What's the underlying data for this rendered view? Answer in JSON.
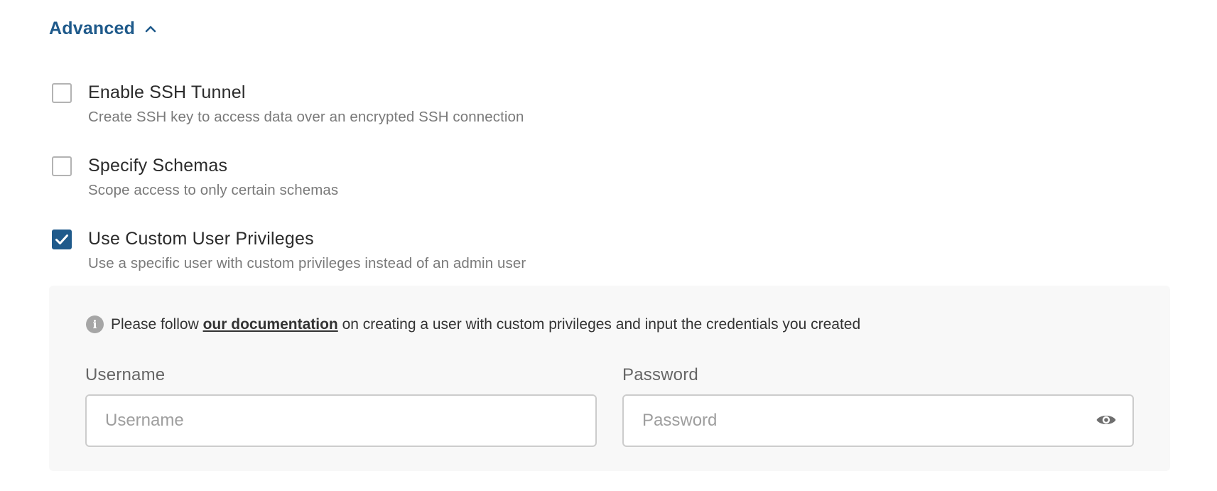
{
  "advanced": {
    "label": "Advanced",
    "expanded": true,
    "icon": "chevron-up-icon",
    "color": "#1f5a8b"
  },
  "options": [
    {
      "title": "Enable SSH Tunnel",
      "description": "Create SSH key to access data over an encrypted SSH connection",
      "checked": false
    },
    {
      "title": "Specify Schemas",
      "description": "Scope access to only certain schemas",
      "checked": false
    },
    {
      "title": "Use Custom User Privileges",
      "description": "Use a specific user with custom privileges instead of an admin user",
      "checked": true
    }
  ],
  "panel": {
    "info_prefix": "Please follow",
    "info_link": "our documentation",
    "info_suffix": "on creating a user with custom privileges and input the credentials you created",
    "info_icon": "info-icon"
  },
  "username": {
    "label": "Username",
    "placeholder": "Username",
    "value": ""
  },
  "password": {
    "label": "Password",
    "placeholder": "Password",
    "value": "",
    "toggle_icon": "eye-icon"
  }
}
